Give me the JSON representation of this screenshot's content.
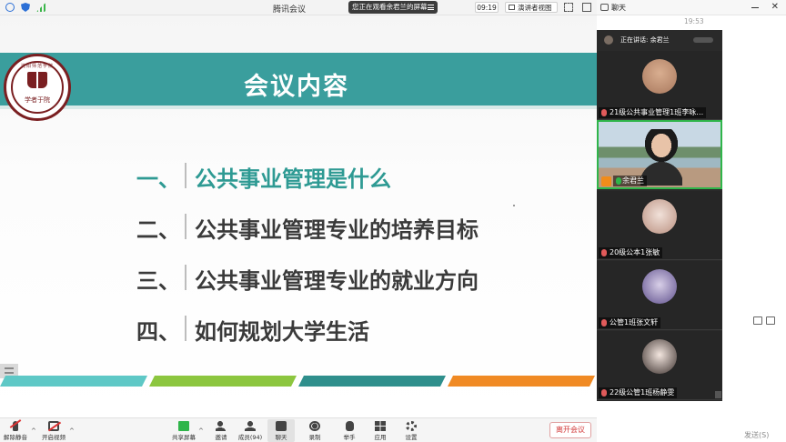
{
  "titlebar": {
    "app_title": "腾讯会议",
    "share_notice": "您正在观看余君兰的屏幕",
    "clock": "09:19",
    "view_mode": "演讲者视图"
  },
  "chat": {
    "title": "聊天",
    "timestamp": "19:53",
    "send_label": "发送(S)"
  },
  "slide": {
    "title": "会议内容",
    "logo_motto": "学者于院",
    "logo_arc": "沈阳师范学院",
    "agenda": [
      {
        "num": "一、",
        "text": "公共事业管理是什么",
        "color": "#2e9a93"
      },
      {
        "num": "二、",
        "text": "公共事业管理专业的培养目标",
        "color": "#3a3a3a"
      },
      {
        "num": "三、",
        "text": "公共事业管理专业的就业方向",
        "color": "#3a3a3a"
      },
      {
        "num": "四、",
        "text": "如何规划大学生活",
        "color": "#3a3a3a"
      }
    ],
    "bar_colors": [
      "#5ec8c6",
      "#8cc63f",
      "#2f8f8c",
      "#f08a24"
    ],
    "banner_color": "#3a9e9d"
  },
  "videos": {
    "speaking_label": "正在讲话: 余君兰",
    "participants": [
      {
        "name": "21级公共事业管理1班李咏…",
        "avatar_color": "#c99b7e"
      },
      {
        "name": "余君兰",
        "avatar_color": "#e8c3a8",
        "active": true
      },
      {
        "name": "20级公本1张敏",
        "avatar_color": "#d8b6a8"
      },
      {
        "name": "公管1班张文轩",
        "avatar_color": "#8f7fb8"
      },
      {
        "name": "22级公管1班杨静雯",
        "avatar_color": "#e6d3c8"
      }
    ]
  },
  "toolbar": {
    "unmute": "解除静音",
    "start_video": "开启视频",
    "share_screen": "共享屏幕",
    "invite": "邀请",
    "members": "成员(94)",
    "chat": "聊天",
    "record": "录制",
    "raise_hand": "举手",
    "apps": "应用",
    "settings": "设置",
    "leave": "离开会议"
  }
}
